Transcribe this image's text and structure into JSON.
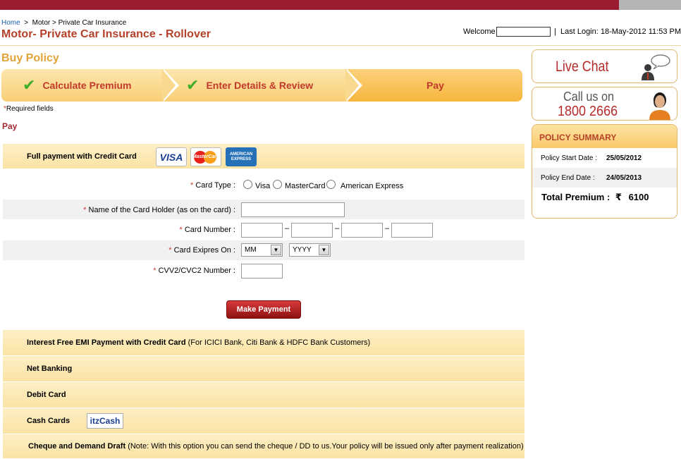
{
  "breadcrumb": {
    "home": "Home",
    "sep1": ">",
    "motor": "Motor",
    "sep2": ">",
    "current": "Private Car Insurance"
  },
  "page_title": "Motor- Private Car Insurance - Rollover",
  "header": {
    "welcome_label": "Welcome",
    "welcome_value": "",
    "divider": "|",
    "last_login": "Last Login: 18-May-2012 11:53 PM"
  },
  "section_title": "Buy Policy",
  "steps": [
    {
      "label": "Calculate Premium",
      "done": true
    },
    {
      "label": "Enter Details & Review",
      "done": true
    },
    {
      "label": "Pay",
      "done": false
    }
  ],
  "required_star": "*",
  "required_note": "Required fields",
  "pay_heading": "Pay",
  "credit_card": {
    "title": "Full payment with Credit Card",
    "logos": {
      "visa": "VISA",
      "mastercard": "MasterCard",
      "amex": "AMERICAN EXPRESS"
    },
    "card_type_label": "Card Type :",
    "card_types": [
      "Visa",
      "MasterCard",
      "American Express"
    ],
    "holder_label": "Name of the Card Holder (as on the card) :",
    "number_label": "Card Number :",
    "number_sep": "–",
    "expiry_label": "Card Exipres On :",
    "month_value": "MM",
    "year_value": "YYYY",
    "cvv_label": "CVV2/CVC2 Number :",
    "star": "*"
  },
  "make_payment": "Make Payment",
  "options": {
    "emi_title": "Interest Free EMI Payment with Credit Card",
    "emi_note": "(For ICICI Bank, Citi Bank & HDFC Bank Customers)",
    "net_banking": "Net Banking",
    "debit_card": "Debit Card",
    "cash_cards": "Cash Cards",
    "itz_logo": "itzCash",
    "cheque_title": "Cheque and Demand Draft",
    "cheque_note": "(Note: With this option you can send the cheque / DD to us.Your policy will be issued only after payment realization)"
  },
  "live_chat": "Live Chat",
  "call_us": {
    "line1": "Call us on",
    "number": "1800 2666"
  },
  "summary": {
    "heading": "POLICY SUMMARY",
    "start_label": "Policy Start Date :",
    "start_value": "25/05/2012",
    "end_label": "Policy End Date :",
    "end_value": "24/05/2013",
    "total_label": "Total Premium :",
    "currency": "₹",
    "total_value": "6100"
  },
  "colors": {
    "brand_red": "#9b1b30",
    "step_gold": "#f9cf76",
    "title_rust": "#b5412a",
    "check_green": "#3fae29"
  }
}
